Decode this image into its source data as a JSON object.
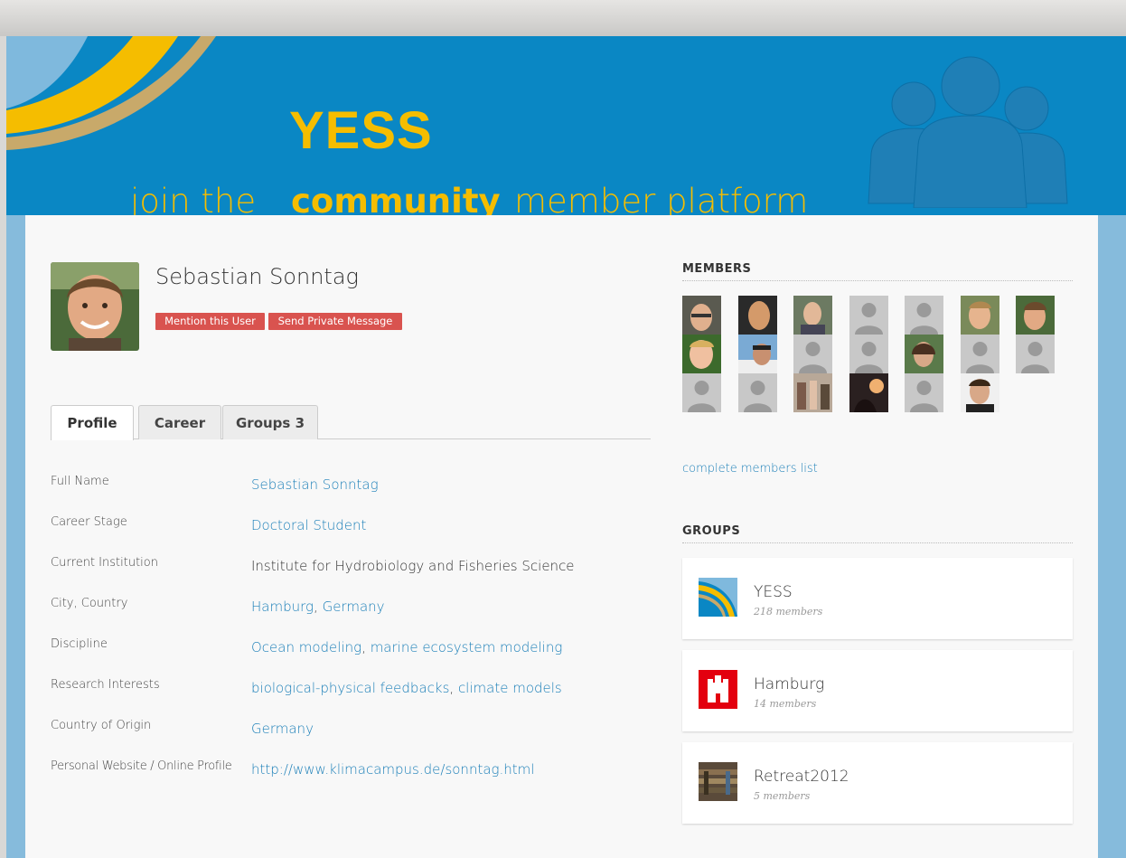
{
  "banner": {
    "yess": "YESS",
    "tagline_join": "join the",
    "tagline_community": "community",
    "tagline_member": "member platform"
  },
  "profile": {
    "name": "Sebastian Sonntag",
    "mention_label": "Mention this User",
    "message_label": "Send Private Message"
  },
  "tabs": [
    {
      "label": "Profile"
    },
    {
      "label": "Career"
    },
    {
      "label": "Groups 3"
    }
  ],
  "fields": [
    {
      "label": "Full Name",
      "value": "Sebastian Sonntag"
    },
    {
      "label": "Career Stage",
      "value": "Doctoral Student"
    },
    {
      "label": "Current Institution",
      "value": "Institute for Hydrobiology and Fisheries Science"
    },
    {
      "label": "City, Country",
      "value_a": "Hamburg",
      "value_b": "Germany"
    },
    {
      "label": "Discipline",
      "value_a": "Ocean modeling",
      "value_b": "marine ecosystem modeling"
    },
    {
      "label": "Research Interests",
      "value_a": "biological-physical feedbacks",
      "value_b": "climate models"
    },
    {
      "label": "Country of Origin",
      "value": "Germany"
    },
    {
      "label": "Personal Website / Online Profile",
      "value": "http://www.klimacampus.de/sonntag.html"
    }
  ],
  "sidebar": {
    "members_title": "MEMBERS",
    "complete_link": "complete members list",
    "groups_title": "GROUPS",
    "groups": [
      {
        "name": "YESS",
        "count": "218 members"
      },
      {
        "name": "Hamburg",
        "count": "14 members"
      },
      {
        "name": "Retreat2012",
        "count": "5 members"
      }
    ]
  },
  "colors": {
    "banner_blue": "#0a87c4",
    "brand_yellow": "#f5bd00",
    "button_red": "#d9534f",
    "link_blue": "#1b7fb8"
  }
}
